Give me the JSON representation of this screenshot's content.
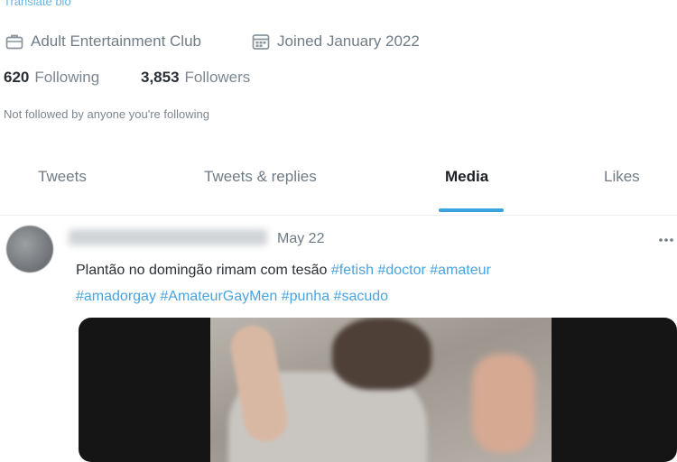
{
  "profile": {
    "translate_bio": "Translate bio",
    "category": "Adult Entertainment Club",
    "joined": "Joined January 2022",
    "following_count": "620",
    "following_label": "Following",
    "followers_count": "3,853",
    "followers_label": "Followers",
    "not_followed": "Not followed by anyone you're following"
  },
  "tabs": [
    {
      "label": "Tweets"
    },
    {
      "label": "Tweets & replies"
    },
    {
      "label": "Media",
      "active": true
    },
    {
      "label": "Likes"
    }
  ],
  "tweet": {
    "date": "May 22",
    "text": "Plantão no domingão rimam com tesão",
    "hashtags": [
      "#fetish",
      "#doctor",
      "#amateur",
      "#amadorgay",
      "#AmateurGayMen",
      "#punha",
      "#sacudo"
    ]
  },
  "icons": {
    "category": "briefcase-icon",
    "joined": "calendar-icon",
    "more": "more-horizontal-icon"
  },
  "colors": {
    "accent": "#1d9bf0",
    "text": "#0f1419",
    "muted": "#536471"
  }
}
